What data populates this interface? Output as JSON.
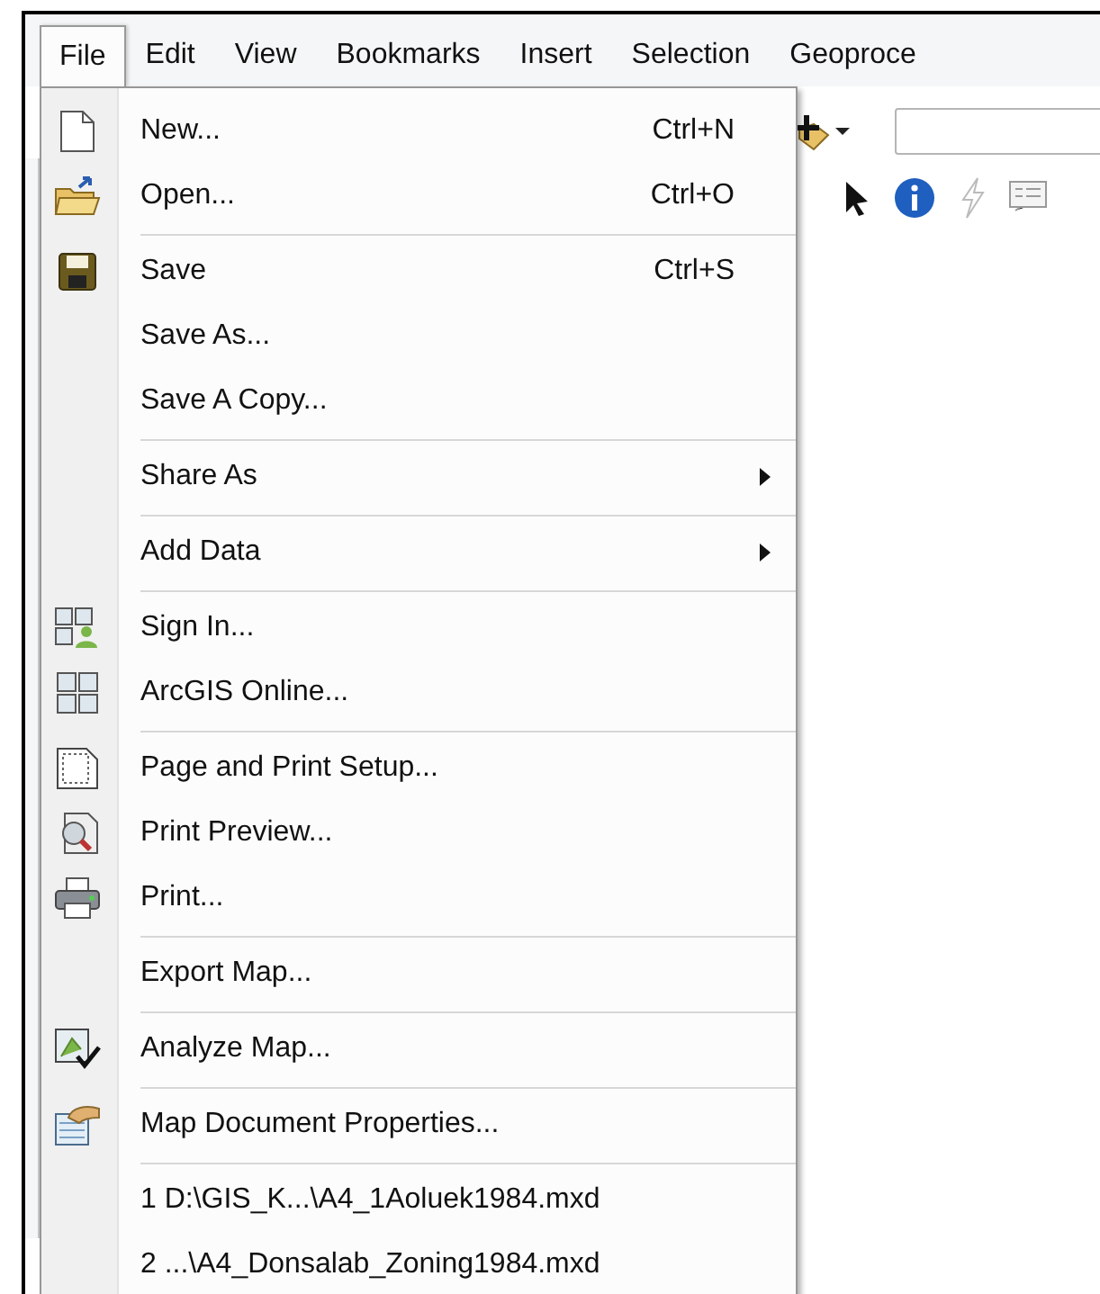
{
  "menubar": [
    {
      "label": "File",
      "selected": true
    },
    {
      "label": "Edit",
      "selected": false
    },
    {
      "label": "View",
      "selected": false
    },
    {
      "label": "Bookmarks",
      "selected": false
    },
    {
      "label": "Insert",
      "selected": false
    },
    {
      "label": "Selection",
      "selected": false
    },
    {
      "label": "Geoproce",
      "selected": false
    }
  ],
  "file_menu": [
    {
      "kind": "command",
      "label": "New...",
      "shortcut": "Ctrl+N",
      "submenu": false
    },
    {
      "kind": "command",
      "label": "Open...",
      "shortcut": "Ctrl+O",
      "submenu": false
    },
    {
      "kind": "separator"
    },
    {
      "kind": "command",
      "label": "Save",
      "shortcut": "Ctrl+S",
      "submenu": false
    },
    {
      "kind": "command",
      "label": "Save As...",
      "submenu": false
    },
    {
      "kind": "command",
      "label": "Save A Copy...",
      "submenu": false
    },
    {
      "kind": "separator"
    },
    {
      "kind": "command",
      "label": "Share As",
      "submenu": true
    },
    {
      "kind": "separator"
    },
    {
      "kind": "command",
      "label": "Add Data",
      "submenu": true
    },
    {
      "kind": "separator"
    },
    {
      "kind": "command",
      "label": "Sign In...",
      "submenu": false
    },
    {
      "kind": "command",
      "label": "ArcGIS Online...",
      "submenu": false
    },
    {
      "kind": "separator"
    },
    {
      "kind": "command",
      "label": "Page and Print Setup...",
      "submenu": false
    },
    {
      "kind": "command",
      "label": "Print Preview...",
      "submenu": false
    },
    {
      "kind": "command",
      "label": "Print...",
      "submenu": false
    },
    {
      "kind": "separator"
    },
    {
      "kind": "command",
      "label": "Export Map...",
      "submenu": false
    },
    {
      "kind": "separator"
    },
    {
      "kind": "command",
      "label": "Analyze Map...",
      "submenu": false
    },
    {
      "kind": "separator"
    },
    {
      "kind": "command",
      "label": "Map Document Properties...",
      "submenu": false
    },
    {
      "kind": "separator"
    },
    {
      "kind": "command",
      "label": "1 D:\\GIS_K...\\A4_1Aoluek1984.mxd",
      "submenu": false
    },
    {
      "kind": "command",
      "label": "2 ...\\A4_Donsalab_Zoning1984.mxd",
      "submenu": false
    }
  ]
}
